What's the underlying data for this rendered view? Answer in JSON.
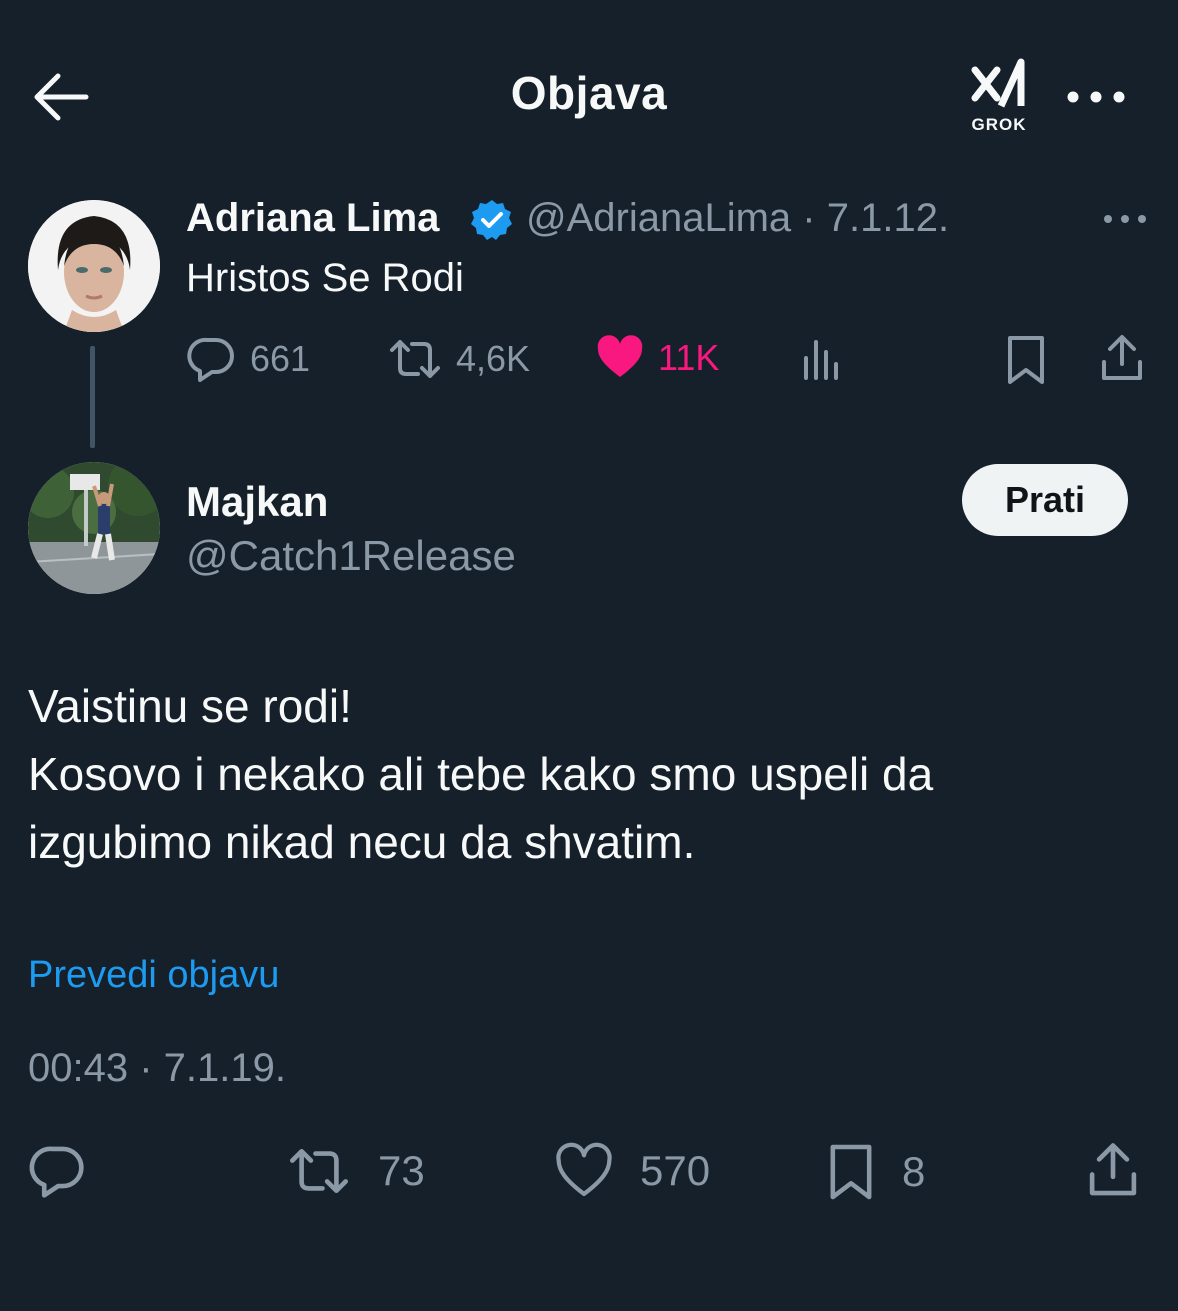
{
  "header": {
    "title": "Objava",
    "grok_label": "GROK",
    "back_icon": "arrow-left-icon",
    "more_icon": "more-horizontal-icon"
  },
  "parent_tweet": {
    "name": "Adriana Lima",
    "handle": "@AdrianaLima",
    "date": "7.1.12.",
    "text": "Hristos Se Rodi",
    "replies": "661",
    "reposts": "4,6K",
    "likes": "11K",
    "verified_color": "#1d9bf0",
    "like_color": "#f91880"
  },
  "main_tweet": {
    "name": "Majkan",
    "handle": "@Catch1Release",
    "follow_label": "Prati",
    "lines": [
      "Vaistinu se rodi!",
      "Kosovo i nekako ali tebe kako smo uspeli da",
      "izgubimo nikad necu da shvatim."
    ],
    "translate_label": "Prevedi objavu",
    "time": "00:43",
    "date": "7.1.19.",
    "reposts": "73",
    "likes": "570",
    "bookmarks": "8"
  },
  "colors": {
    "background": "#15202b",
    "text": "#f7f9f9",
    "muted": "#8b98a5",
    "link": "#1d9bf0"
  }
}
